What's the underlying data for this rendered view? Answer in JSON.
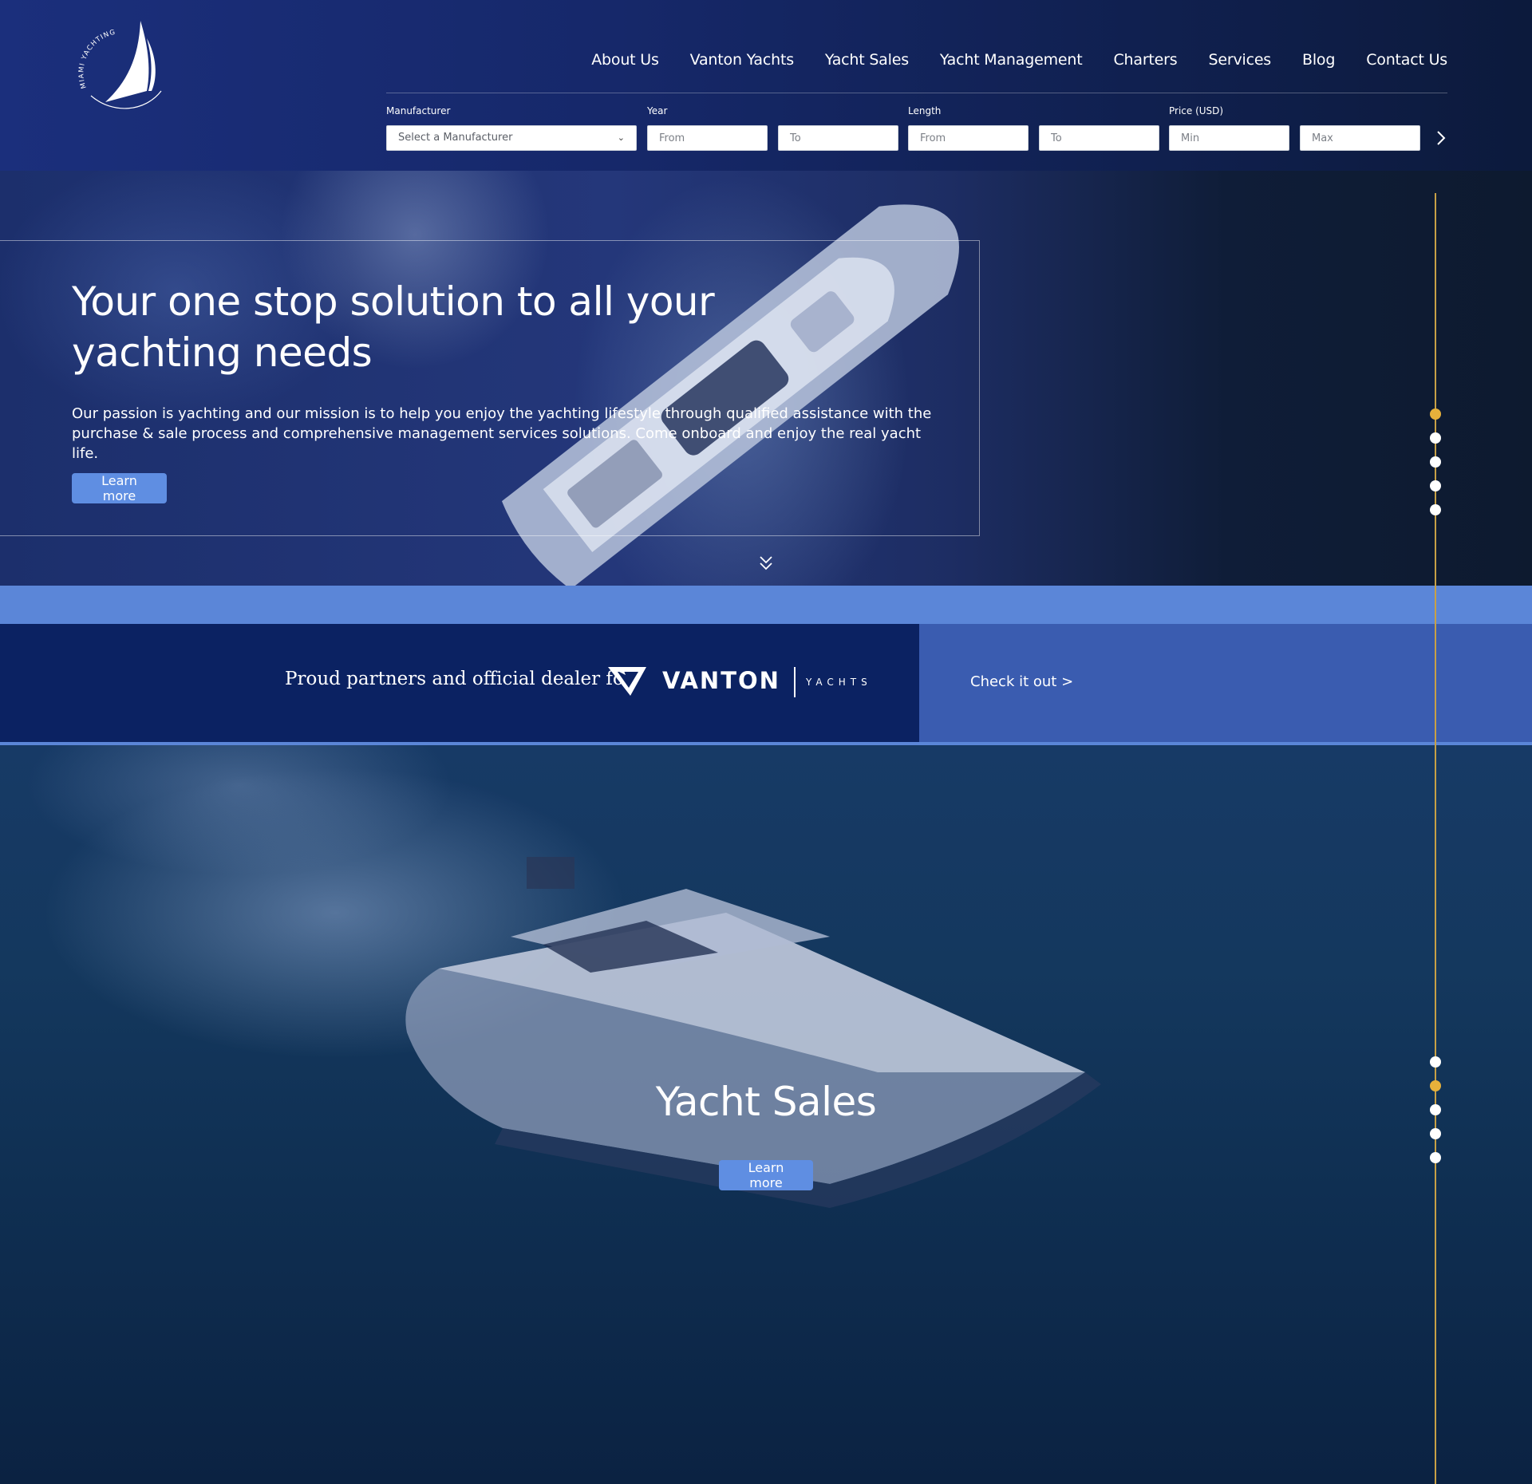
{
  "logo": {
    "text": "MIAMI YACHTING"
  },
  "nav": {
    "items": [
      "About Us",
      "Vanton Yachts",
      "Yacht Sales",
      "Yacht Management",
      "Charters",
      "Services",
      "Blog",
      "Contact Us"
    ]
  },
  "search": {
    "manufacturer_label": "Manufacturer",
    "manufacturer_value": "Select a Manufacturer",
    "year_label": "Year",
    "year_from_placeholder": "From",
    "year_to_placeholder": "To",
    "length_label": "Length",
    "length_from_placeholder": "From",
    "length_to_placeholder": "To",
    "price_label": "Price (USD)",
    "price_min_placeholder": "Min",
    "price_max_placeholder": "Max"
  },
  "hero": {
    "title": "Your one stop solution to all your yachting needs",
    "text": "Our passion is yachting and our mission is to help you enjoy the yachting lifestyle through qualified assistance with the purchase & sale process and comprehensive management services solutions. Come onboard and enjoy the real yacht life.",
    "button": "Learn more"
  },
  "partner": {
    "text": "Proud partners and official dealer for",
    "brand": "VANTON",
    "brand_sub": "YACHTS",
    "link": "Check it out >"
  },
  "sales": {
    "title": "Yacht Sales",
    "button": "Learn more"
  },
  "pager": {
    "hero_active_index": 0,
    "sales_active_index": 1,
    "count": 5
  },
  "colors": {
    "accent": "#5f8ee2",
    "dot_active": "#e7b13b",
    "rail": "#c7a046",
    "partner_bg": "#0b2262",
    "partner_link_bg": "#3a5cb0"
  }
}
